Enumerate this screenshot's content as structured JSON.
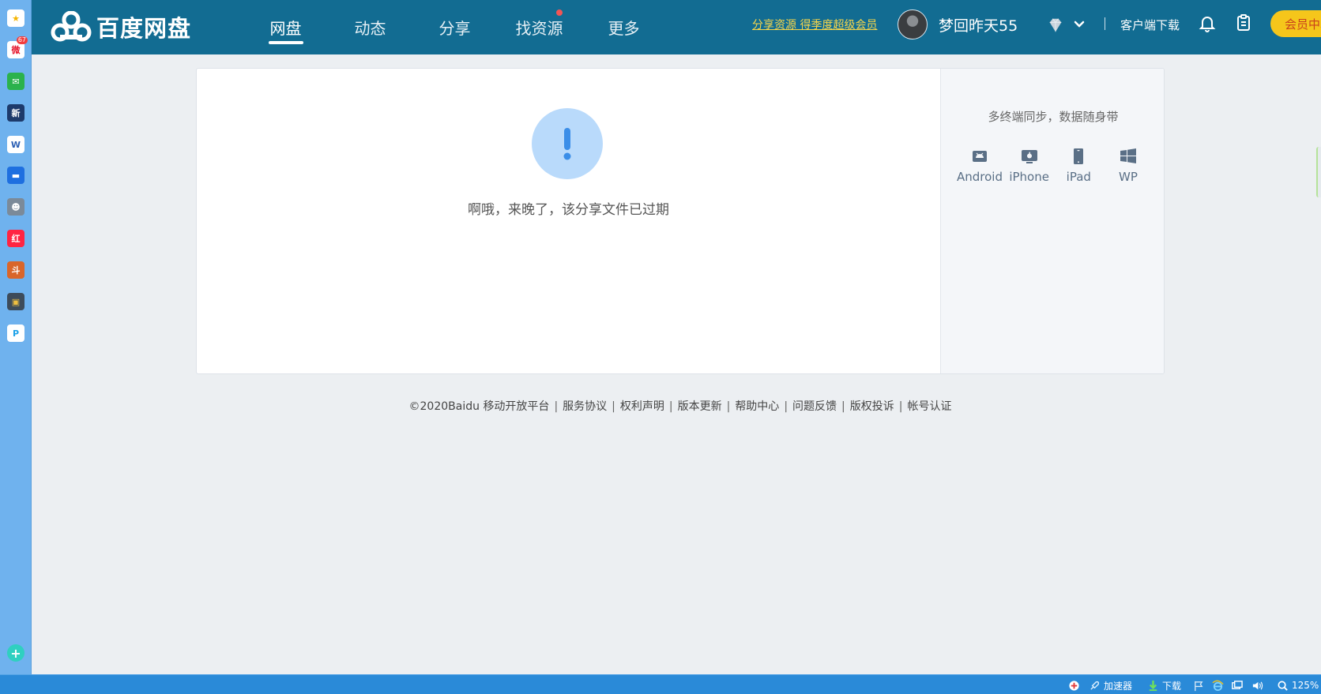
{
  "sidebar": {
    "apps": [
      {
        "name": "favorites-star-icon",
        "color": "#ffffff",
        "fg": "#f5b400",
        "glyph": "★",
        "badge": ""
      },
      {
        "name": "weibo-icon",
        "color": "#ffffff",
        "fg": "#e6162d",
        "glyph": "微",
        "badge": "67"
      },
      {
        "name": "mail-icon",
        "color": "#2bb24c",
        "fg": "#ffffff",
        "glyph": "✉",
        "badge": ""
      },
      {
        "name": "news-app-icon",
        "color": "#1d3a6b",
        "fg": "#ffffff",
        "glyph": "新",
        "badge": ""
      },
      {
        "name": "word-doc-icon",
        "color": "#ffffff",
        "fg": "#2b5fb4",
        "glyph": "W",
        "badge": ""
      },
      {
        "name": "chat-app-icon",
        "color": "#1e6fe0",
        "fg": "#ffffff",
        "glyph": "▬",
        "badge": ""
      },
      {
        "name": "game-character-icon",
        "color": "#7b8a99",
        "fg": "#ffffff",
        "glyph": "☻",
        "badge": ""
      },
      {
        "name": "xiaohongshu-icon",
        "color": "#ff2442",
        "fg": "#ffffff",
        "glyph": "红",
        "badge": ""
      },
      {
        "name": "game-fighter-icon",
        "color": "#d9662b",
        "fg": "#ffffff",
        "glyph": "斗",
        "badge": ""
      },
      {
        "name": "game-chest-icon",
        "color": "#3d4b5a",
        "fg": "#f0c040",
        "glyph": "▣",
        "badge": ""
      },
      {
        "name": "pdf-app-icon",
        "color": "#ffffff",
        "fg": "#1aa0e8",
        "glyph": "P",
        "badge": ""
      }
    ]
  },
  "header": {
    "logo_text": "百度网盘",
    "nav": [
      {
        "label": "网盘",
        "active": true,
        "dot": false
      },
      {
        "label": "动态",
        "active": false,
        "dot": false
      },
      {
        "label": "分享",
        "active": false,
        "dot": false
      },
      {
        "label": "找资源",
        "active": false,
        "dot": true
      },
      {
        "label": "更多",
        "active": false,
        "dot": false
      }
    ],
    "promo_link": "分享资源 得季度超级会员",
    "username": "梦回昨天55",
    "client_download": "客户端下载",
    "vip_button": "会员中心"
  },
  "main": {
    "alert_message": "啊哦，来晚了，该分享文件已过期"
  },
  "side": {
    "title": "多终端同步，数据随身带",
    "platforms": [
      "Android",
      "iPhone",
      "iPad",
      "WP"
    ]
  },
  "footer": {
    "copyright": "©2020Baidu",
    "links": [
      "移动开放平台",
      "服务协议",
      "权利声明",
      "版本更新",
      "帮助中心",
      "问题反馈",
      "版权投诉",
      "帐号认证"
    ]
  },
  "taskbar": {
    "accelerator": "加速器",
    "download": "下载",
    "zoom": "125%"
  },
  "colors": {
    "header_bg": "#126c92",
    "vip_yellow": "#f5c61b",
    "promo_yellow": "#f7d64a",
    "alert_blue": "#3b8ee8"
  }
}
